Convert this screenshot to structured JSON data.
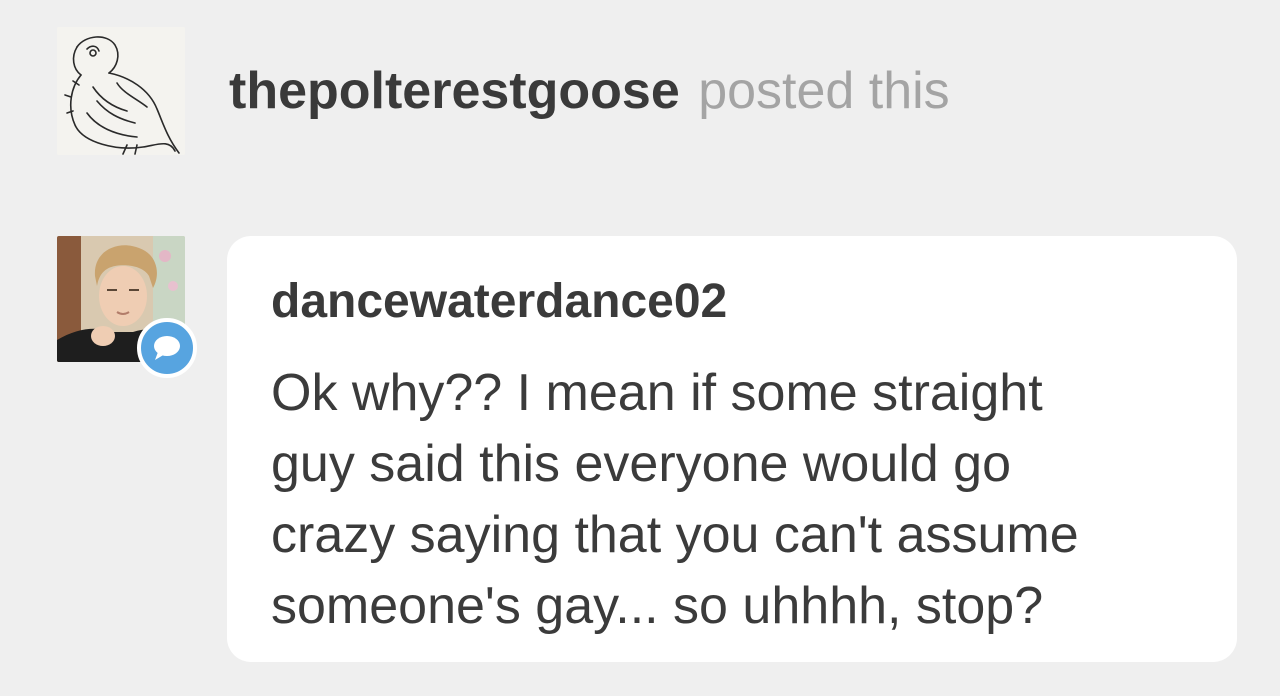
{
  "post": {
    "username": "thepolterestgoose",
    "action": "posted this",
    "avatar_icon": "owl-sketch-avatar"
  },
  "reply": {
    "username": "dancewaterdance02",
    "avatar_icon": "user-photo-avatar",
    "badge_icon": "reply-speech-bubble-icon",
    "badge_color": "#57a4e0",
    "lines": [
      "Ok why?? I mean if some straight",
      "guy said this everyone would go",
      "crazy saying that you can't assume",
      "someone's gay... so uhhhh, stop?"
    ]
  }
}
